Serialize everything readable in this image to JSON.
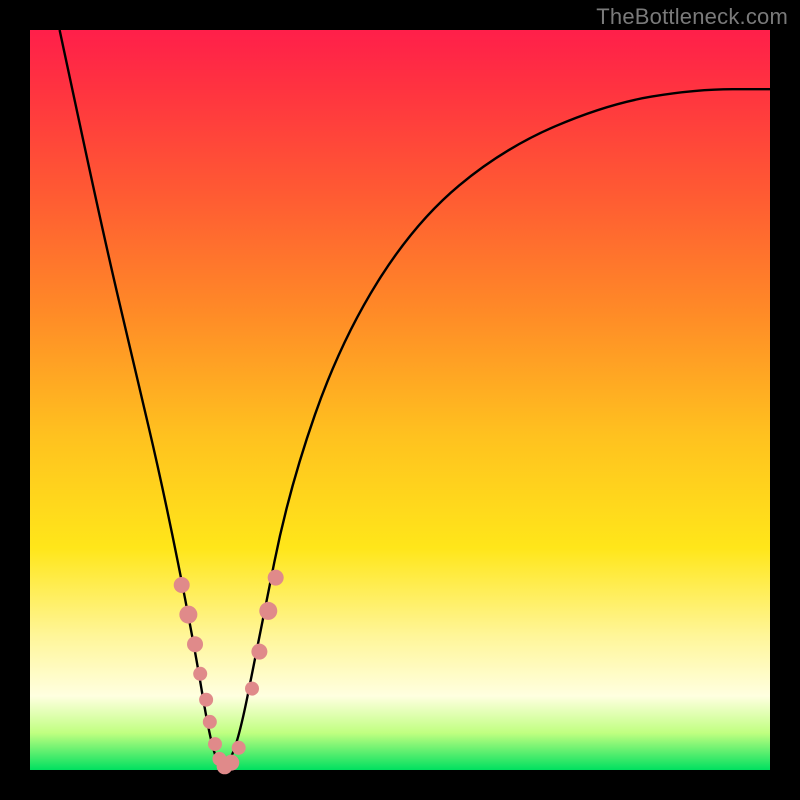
{
  "watermark": "TheBottleneck.com",
  "chart_data": {
    "type": "line",
    "title": "",
    "xlabel": "",
    "ylabel": "",
    "xlim": [
      0,
      1
    ],
    "ylim": [
      0,
      1
    ],
    "grid": false,
    "series": [
      {
        "name": "bottleneck-curve",
        "color": "#000000",
        "x": [
          0.04,
          0.1,
          0.14,
          0.18,
          0.22,
          0.245,
          0.26,
          0.28,
          0.31,
          0.35,
          0.42,
          0.52,
          0.64,
          0.78,
          0.9,
          1.0
        ],
        "y": [
          1.0,
          0.72,
          0.55,
          0.38,
          0.18,
          0.03,
          0.0,
          0.03,
          0.18,
          0.38,
          0.58,
          0.74,
          0.84,
          0.9,
          0.92,
          0.92
        ]
      }
    ],
    "markers": {
      "name": "highlight-points",
      "color": "#e08a8a",
      "points": [
        {
          "x": 0.205,
          "y": 0.25,
          "r": 8
        },
        {
          "x": 0.214,
          "y": 0.21,
          "r": 9
        },
        {
          "x": 0.223,
          "y": 0.17,
          "r": 8
        },
        {
          "x": 0.23,
          "y": 0.13,
          "r": 7
        },
        {
          "x": 0.238,
          "y": 0.095,
          "r": 7
        },
        {
          "x": 0.243,
          "y": 0.065,
          "r": 7
        },
        {
          "x": 0.25,
          "y": 0.035,
          "r": 7
        },
        {
          "x": 0.256,
          "y": 0.015,
          "r": 7
        },
        {
          "x": 0.263,
          "y": 0.005,
          "r": 8
        },
        {
          "x": 0.272,
          "y": 0.01,
          "r": 8
        },
        {
          "x": 0.282,
          "y": 0.03,
          "r": 7
        },
        {
          "x": 0.3,
          "y": 0.11,
          "r": 7
        },
        {
          "x": 0.31,
          "y": 0.16,
          "r": 8
        },
        {
          "x": 0.322,
          "y": 0.215,
          "r": 9
        },
        {
          "x": 0.332,
          "y": 0.26,
          "r": 8
        }
      ]
    }
  }
}
